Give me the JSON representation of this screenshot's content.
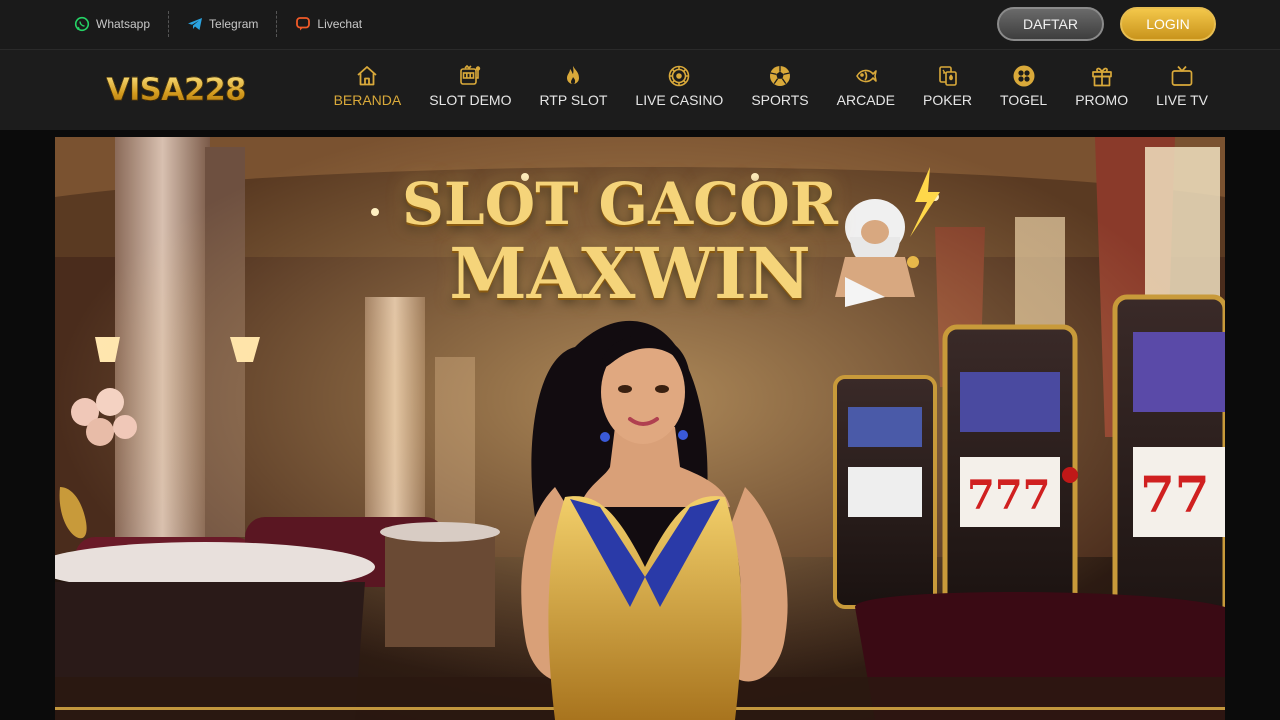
{
  "topbar": {
    "contacts": [
      {
        "label": "Whatsapp",
        "icon": "whatsapp-icon",
        "color": "#25d366"
      },
      {
        "label": "Telegram",
        "icon": "telegram-icon",
        "color": "#2aa3e0"
      },
      {
        "label": "Livechat",
        "icon": "livechat-icon",
        "color": "#f05a28"
      }
    ],
    "daftar_label": "DAFTAR",
    "login_label": "LOGIN"
  },
  "brand": {
    "logo_text": "VISA228",
    "accent": "#d9a93a"
  },
  "nav": {
    "items": [
      {
        "label": "BERANDA",
        "icon": "home-icon",
        "active": true
      },
      {
        "label": "SLOT DEMO",
        "icon": "slot-machine-icon"
      },
      {
        "label": "RTP SLOT",
        "icon": "flame-icon"
      },
      {
        "label": "LIVE CASINO",
        "icon": "roulette-icon"
      },
      {
        "label": "SPORTS",
        "icon": "soccer-ball-icon"
      },
      {
        "label": "ARCADE",
        "icon": "fish-icon"
      },
      {
        "label": "POKER",
        "icon": "cards-icon"
      },
      {
        "label": "TOGEL",
        "icon": "lottery-balls-icon"
      },
      {
        "label": "PROMO",
        "icon": "gift-icon"
      },
      {
        "label": "LIVE TV",
        "icon": "tv-icon"
      }
    ]
  },
  "banner": {
    "headline_line1": "SLOT GACOR",
    "headline_line2": "MAXWIN"
  }
}
